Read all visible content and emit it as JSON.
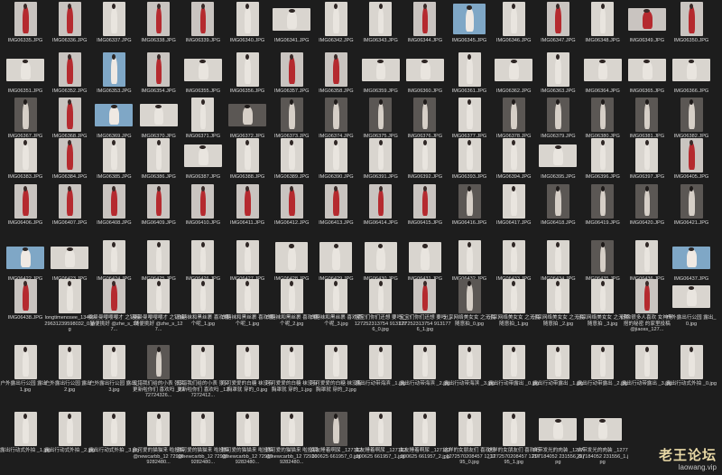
{
  "watermark": {
    "logo": "老王论坛",
    "url": "laowang.vip"
  },
  "colors": {
    "background": "#1d1d1d",
    "label": "#d8d8d8"
  },
  "files": [
    {
      "name": "IMG06335.JPG",
      "kind": "portrait",
      "tone": "red"
    },
    {
      "name": "IMG06336.JPG",
      "kind": "portrait",
      "tone": "red"
    },
    {
      "name": "IMG06337.JPG",
      "kind": "portrait",
      "tone": "light"
    },
    {
      "name": "IMG06338.JPG",
      "kind": "portrait",
      "tone": "red"
    },
    {
      "name": "IMG06339.JPG",
      "kind": "portrait",
      "tone": "red"
    },
    {
      "name": "IMG06340.JPG",
      "kind": "portrait",
      "tone": "light"
    },
    {
      "name": "IMG06341.JPG",
      "kind": "landscape",
      "tone": "light"
    },
    {
      "name": "IMG06342.JPG",
      "kind": "portrait",
      "tone": "light"
    },
    {
      "name": "IMG06343.JPG",
      "kind": "portrait",
      "tone": "light"
    },
    {
      "name": "IMG06344.JPG",
      "kind": "portrait",
      "tone": "red"
    },
    {
      "name": "IMG06345.JPG",
      "kind": "square",
      "tone": "blue"
    },
    {
      "name": "IMG06346.JPG",
      "kind": "portrait",
      "tone": "light"
    },
    {
      "name": "IMG06347.JPG",
      "kind": "portrait",
      "tone": "red"
    },
    {
      "name": "IMG06348.JPG",
      "kind": "portrait",
      "tone": "light"
    },
    {
      "name": "IMG06349.JPG",
      "kind": "landscape",
      "tone": "red"
    },
    {
      "name": "IMG06350.JPG",
      "kind": "portrait",
      "tone": "red"
    },
    {
      "name": "IMG06351.JPG",
      "kind": "landscape",
      "tone": "light"
    },
    {
      "name": "IMG06352.JPG",
      "kind": "portrait",
      "tone": "red"
    },
    {
      "name": "IMG06353.JPG",
      "kind": "portrait",
      "tone": "blue"
    },
    {
      "name": "IMG06354.JPG",
      "kind": "portrait",
      "tone": "red"
    },
    {
      "name": "IMG06355.JPG",
      "kind": "landscape",
      "tone": "light"
    },
    {
      "name": "IMG06356.JPG",
      "kind": "portrait",
      "tone": "light"
    },
    {
      "name": "IMG06357.JPG",
      "kind": "portrait",
      "tone": "red"
    },
    {
      "name": "IMG06358.JPG",
      "kind": "portrait",
      "tone": "red"
    },
    {
      "name": "IMG06359.JPG",
      "kind": "landscape",
      "tone": "light"
    },
    {
      "name": "IMG06360.JPG",
      "kind": "landscape",
      "tone": "light"
    },
    {
      "name": "IMG06361.JPG",
      "kind": "portrait",
      "tone": "light"
    },
    {
      "name": "IMG06362.JPG",
      "kind": "landscape",
      "tone": "light"
    },
    {
      "name": "IMG06363.JPG",
      "kind": "portrait",
      "tone": "light"
    },
    {
      "name": "IMG06364.JPG",
      "kind": "landscape",
      "tone": "light"
    },
    {
      "name": "IMG06365.JPG",
      "kind": "landscape",
      "tone": "light"
    },
    {
      "name": "IMG06366.JPG",
      "kind": "landscape",
      "tone": "light"
    },
    {
      "name": "IMG06367.JPG",
      "kind": "portrait",
      "tone": "dark"
    },
    {
      "name": "IMG06368.JPG",
      "kind": "portrait",
      "tone": "red"
    },
    {
      "name": "IMG06369.JPG",
      "kind": "landscape",
      "tone": "blue"
    },
    {
      "name": "IMG06370.JPG",
      "kind": "landscape",
      "tone": "light"
    },
    {
      "name": "IMG06371.JPG",
      "kind": "portrait",
      "tone": "light"
    },
    {
      "name": "IMG06372.JPG",
      "kind": "landscape",
      "tone": "dark"
    },
    {
      "name": "IMG06373.JPG",
      "kind": "portrait",
      "tone": "dark"
    },
    {
      "name": "IMG06374.JPG",
      "kind": "portrait",
      "tone": "dark"
    },
    {
      "name": "IMG06375.JPG",
      "kind": "portrait",
      "tone": "dark"
    },
    {
      "name": "IMG06376.JPG",
      "kind": "portrait",
      "tone": "dark"
    },
    {
      "name": "IMG06377.JPG",
      "kind": "portrait",
      "tone": "light"
    },
    {
      "name": "IMG06378.JPG",
      "kind": "portrait",
      "tone": "dark"
    },
    {
      "name": "IMG06379.JPG",
      "kind": "portrait",
      "tone": "dark"
    },
    {
      "name": "IMG06380.JPG",
      "kind": "portrait",
      "tone": "dark"
    },
    {
      "name": "IMG06381.JPG",
      "kind": "portrait",
      "tone": "dark"
    },
    {
      "name": "IMG06382.JPG",
      "kind": "portrait",
      "tone": "dark"
    },
    {
      "name": "IMG06383.JPG",
      "kind": "portrait",
      "tone": "light"
    },
    {
      "name": "IMG06384.JPG",
      "kind": "portrait",
      "tone": "red"
    },
    {
      "name": "IMG06385.JPG",
      "kind": "portrait",
      "tone": "light"
    },
    {
      "name": "IMG06386.JPG",
      "kind": "portrait",
      "tone": "light"
    },
    {
      "name": "IMG06387.JPG",
      "kind": "landscape",
      "tone": "light"
    },
    {
      "name": "IMG06388.JPG",
      "kind": "portrait",
      "tone": "light"
    },
    {
      "name": "IMG06389.JPG",
      "kind": "portrait",
      "tone": "light"
    },
    {
      "name": "IMG06390.JPG",
      "kind": "portrait",
      "tone": "light"
    },
    {
      "name": "IMG06391.JPG",
      "kind": "portrait",
      "tone": "light"
    },
    {
      "name": "IMG06392.JPG",
      "kind": "portrait",
      "tone": "light"
    },
    {
      "name": "IMG06393.JPG",
      "kind": "portrait",
      "tone": "light"
    },
    {
      "name": "IMG06394.JPG",
      "kind": "portrait",
      "tone": "light"
    },
    {
      "name": "IMG06395.JPG",
      "kind": "landscape",
      "tone": "light"
    },
    {
      "name": "IMG06396.JPG",
      "kind": "portrait",
      "tone": "light"
    },
    {
      "name": "IMG06397.JPG",
      "kind": "portrait",
      "tone": "light"
    },
    {
      "name": "IMG06405.JPG",
      "kind": "portrait",
      "tone": "red"
    },
    {
      "name": "IMG06406.JPG",
      "kind": "portrait",
      "tone": "red"
    },
    {
      "name": "IMG06407.JPG",
      "kind": "portrait",
      "tone": "red"
    },
    {
      "name": "IMG06408.JPG",
      "kind": "portrait",
      "tone": "red"
    },
    {
      "name": "IMG06409.JPG",
      "kind": "portrait",
      "tone": "red"
    },
    {
      "name": "IMG06410.JPG",
      "kind": "portrait",
      "tone": "red"
    },
    {
      "name": "IMG06411.JPG",
      "kind": "portrait",
      "tone": "red"
    },
    {
      "name": "IMG06412.JPG",
      "kind": "portrait",
      "tone": "red"
    },
    {
      "name": "IMG06413.JPG",
      "kind": "portrait",
      "tone": "red"
    },
    {
      "name": "IMG06414.JPG",
      "kind": "portrait",
      "tone": "red"
    },
    {
      "name": "IMG06415.JPG",
      "kind": "portrait",
      "tone": "red"
    },
    {
      "name": "IMG06416.JPG",
      "kind": "portrait",
      "tone": "dark"
    },
    {
      "name": "IMG06417.JPG",
      "kind": "portrait",
      "tone": "light"
    },
    {
      "name": "IMG06418.JPG",
      "kind": "portrait",
      "tone": "dark"
    },
    {
      "name": "IMG06419.JPG",
      "kind": "portrait",
      "tone": "dark"
    },
    {
      "name": "IMG06420.JPG",
      "kind": "portrait",
      "tone": "dark"
    },
    {
      "name": "IMG06421.JPG",
      "kind": "portrait",
      "tone": "dark"
    },
    {
      "name": "IMG06422.JPG",
      "kind": "landscape",
      "tone": "blue"
    },
    {
      "name": "IMG06423.JPG",
      "kind": "landscape",
      "tone": "light"
    },
    {
      "name": "IMG06424.JPG",
      "kind": "portrait",
      "tone": "light"
    },
    {
      "name": "IMG06425.JPG",
      "kind": "portrait",
      "tone": "light"
    },
    {
      "name": "IMG06426.JPG",
      "kind": "portrait",
      "tone": "light"
    },
    {
      "name": "IMG06427.JPG",
      "kind": "portrait",
      "tone": "light"
    },
    {
      "name": "IMG06428.JPG",
      "kind": "square",
      "tone": "light"
    },
    {
      "name": "IMG06429.JPG",
      "kind": "square",
      "tone": "light"
    },
    {
      "name": "IMG06430.JPG",
      "kind": "square",
      "tone": "light"
    },
    {
      "name": "IMG06431.JPG",
      "kind": "square",
      "tone": "light"
    },
    {
      "name": "IMG06432.JPG",
      "kind": "portrait",
      "tone": "light"
    },
    {
      "name": "IMG06433.JPG",
      "kind": "portrait",
      "tone": "light"
    },
    {
      "name": "IMG06434.JPG",
      "kind": "portrait",
      "tone": "light"
    },
    {
      "name": "IMG06435.JPG",
      "kind": "portrait",
      "tone": "dark"
    },
    {
      "name": "IMG06436.JPG",
      "kind": "portrait",
      "tone": "light"
    },
    {
      "name": "IMG06437.JPG",
      "kind": "landscape",
      "tone": "blue"
    },
    {
      "name": "IMG06438.JPG",
      "kind": "portrait",
      "tone": "red"
    },
    {
      "name": "longtimenosee_1340929631239598032_0.jpg",
      "kind": "portrait",
      "tone": "light"
    },
    {
      "name": "曼曼曼嘤嘤嘤才 之链接随便挑好 @zhe_s_127...",
      "kind": "portrait",
      "tone": "red"
    },
    {
      "name": "曼曼曼嘤嘤嘤才 之链接随便挑好 @zhe_s_127...",
      "kind": "portrait",
      "tone": "light"
    },
    {
      "name": "白糖袜和黑丝裹 喜欢哪个呢_1.jpg",
      "kind": "portrait",
      "tone": "light"
    },
    {
      "name": "白糖袜和黑丝裹 喜欢哪个呢_1.jpg",
      "kind": "portrait",
      "tone": "light"
    },
    {
      "name": "白糖袜和黑丝裹 喜欢哪个呢_2.jpg",
      "kind": "portrait",
      "tone": "light"
    },
    {
      "name": "白糖袜和黑丝裹 喜欢哪个呢_3.jpg",
      "kind": "portrait",
      "tone": "light"
    },
    {
      "name": "宝宝们你们还想 要吗 _127252313754 9131776_0.jpg",
      "kind": "portrait",
      "tone": "light"
    },
    {
      "name": "宝宝们你们还想 要吗 _127252313754 9131776_1.jpg",
      "kind": "portrait",
      "tone": "red"
    },
    {
      "name": "分享网络美女女 之无套随意拍_0.jpg",
      "kind": "portrait",
      "tone": "dark"
    },
    {
      "name": "分享网络美女女 之无套随意拍_1.jpg",
      "kind": "portrait",
      "tone": "light"
    },
    {
      "name": "分享网络美女女 之无套随意拍 _2.jpg",
      "kind": "portrait",
      "tone": "light"
    },
    {
      "name": "分享网络美女女 之无套随意拍 _3.jpg",
      "kind": "portrait",
      "tone": "light"
    },
    {
      "name": "好像很多人喜欢 女神穿搭的秘密 的家里投稿 @jiaoss_127...",
      "kind": "portrait",
      "tone": "red"
    },
    {
      "name": "户外露出行公园 露出_0.jpg",
      "kind": "landscape",
      "tone": "light"
    },
    {
      "name": "户外露出行公园 露出_1.jpg",
      "kind": "portrait",
      "tone": "light"
    },
    {
      "name": "户外露出行公园 露出_2.jpg",
      "kind": "portrait",
      "tone": "light"
    },
    {
      "name": "户外露出行公园 露出_3.jpg",
      "kind": "portrait",
      "tone": "light"
    },
    {
      "name": "没错我们给的小表 张又更新啦你们 喜欢吗 _1272724326...",
      "kind": "portrait",
      "tone": "dark"
    },
    {
      "name": "没错我们给的小表 张又更新啦你们 喜欢吗 _127272412...",
      "kind": "portrait",
      "tone": "light"
    },
    {
      "name": "可可爱爱的白糖 袜没有胸罩就 穿的_0.jpg",
      "kind": "portrait",
      "tone": "light"
    },
    {
      "name": "可可爱爱的白糖 袜没有胸罩就 穿的_1.jpg",
      "kind": "portrait",
      "tone": "light"
    },
    {
      "name": "可可爱爱的白糖 袜没有胸罩就 穿的_2.jpg",
      "kind": "portrait",
      "tone": "light"
    },
    {
      "name": "露出行动带海滨 _1.jpg",
      "kind": "portrait",
      "tone": "light"
    },
    {
      "name": "露出行动带海滨 _2.jpg",
      "kind": "portrait",
      "tone": "light"
    },
    {
      "name": "露出行动带海滨 _3.jpg",
      "kind": "portrait",
      "tone": "light"
    },
    {
      "name": "露出行动带露出 _0.jpg",
      "kind": "portrait",
      "tone": "light"
    },
    {
      "name": "露出行动带露出 _1.jpg",
      "kind": "portrait",
      "tone": "light"
    },
    {
      "name": "露出行动带露出 _2.jpg",
      "kind": "portrait",
      "tone": "light"
    },
    {
      "name": "露出行动带露出 _3.jpg",
      "kind": "portrait",
      "tone": "light"
    },
    {
      "name": "露出行动式外拍 _0.jpg",
      "kind": "portrait",
      "tone": "light"
    },
    {
      "name": "露出行动式外拍 _1.jpg",
      "kind": "portrait",
      "tone": "light"
    },
    {
      "name": "露出行动式外拍 _2.jpg",
      "kind": "portrait",
      "tone": "light"
    },
    {
      "name": "露出行动式外拍 _3.jpg",
      "kind": "portrait",
      "tone": "light"
    },
    {
      "name": "你可爱的猫猫来 啦投稿 @newcarbb_12 729169282480...",
      "kind": "portrait",
      "tone": "light"
    },
    {
      "name": "你可爱的猫猫来 啦投稿 @newcarbb_12 729169282480...",
      "kind": "portrait",
      "tone": "light"
    },
    {
      "name": "你可爱的猫猫来 啦投稿 @newcarbb_12 729169282480...",
      "kind": "portrait",
      "tone": "light"
    },
    {
      "name": "你可爱的猫猫来 啦投稿 @newcarbb_12 729169282480...",
      "kind": "portrait",
      "tone": "light"
    },
    {
      "name": "女友睡着啊尿 _127182300625 661957_0.jpg",
      "kind": "portrait",
      "tone": "dark"
    },
    {
      "name": "女友睡着啊尿 _127182300625 661957_1.jpg",
      "kind": "portrait",
      "tone": "light"
    },
    {
      "name": "女友睡着啊尿 _127182300625 661957_2.jpg",
      "kind": "portrait",
      "tone": "light"
    },
    {
      "name": "这样的女朋友们 喜欢吗 _1272570208457 121795_0.jpg",
      "kind": "portrait",
      "tone": "light"
    },
    {
      "name": "这样的女朋友们 喜欢吗 _1272570208457 121795_1.jpg",
      "kind": "portrait",
      "tone": "light"
    },
    {
      "name": "自带发光的肉装 _1277297184052 231556_0.jpg",
      "kind": "landscape",
      "tone": "light"
    },
    {
      "name": "自带发光的肉装 _1277297184052 231556_1.jpg",
      "kind": "landscape",
      "tone": "light"
    }
  ]
}
